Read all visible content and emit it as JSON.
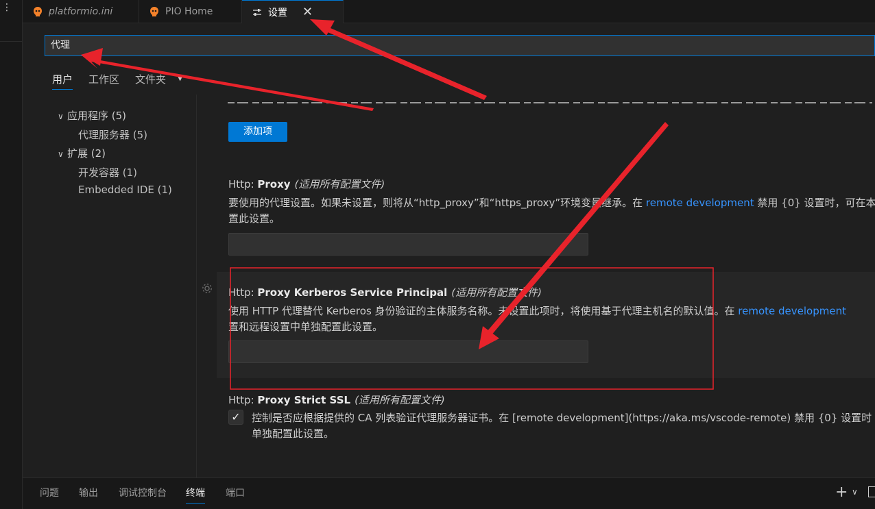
{
  "tabs": [
    {
      "label": "platformio.ini",
      "icon": "platformio-icon"
    },
    {
      "label": "PIO Home",
      "icon": "platformio-icon"
    },
    {
      "label": "设置",
      "icon": "settings-sliders-icon",
      "close": "✕"
    }
  ],
  "activity": {
    "more": "⋮"
  },
  "search": {
    "value": "代理"
  },
  "scope_tabs": [
    "用户",
    "工作区",
    "文件夹"
  ],
  "toc": [
    {
      "label": "应用程序 (5)",
      "chevron": "∨"
    },
    {
      "label": "代理服务器 (5)"
    },
    {
      "label": "扩展 (2)",
      "chevron": "∨"
    },
    {
      "label": "开发容器 (1)"
    },
    {
      "label": "Embedded IDE (1)"
    }
  ],
  "add_button": "添加项",
  "settings": {
    "proxy": {
      "category": "Http: ",
      "name": "Proxy",
      "hint": "(适用所有配置文件)",
      "desc_line1_a": "要使用的代理设置。如果未设置，则将从“http_proxy”和“https_proxy”环境变量继承。在 ",
      "desc_link": "remote development",
      "desc_line1_b": " 禁用 {0} 设置时，可在本",
      "desc_line2": "置此设置。"
    },
    "kerberos": {
      "category": "Http: ",
      "name": "Proxy Kerberos Service Principal",
      "hint": "(适用所有配置文件)",
      "desc_line1_a": "使用 HTTP 代理替代 Kerberos 身份验证的主体服务名称。未设置此项时，将使用基于代理主机名的默认值。在 ",
      "desc_link": "remote development",
      "desc_line2": "置和远程设置中单独配置此设置。"
    },
    "strict_ssl": {
      "category": "Http: ",
      "name": "Proxy Strict SSL",
      "hint": "(适用所有配置文件)",
      "checked": "✓",
      "desc_line1": "控制是否应根据提供的 CA 列表验证代理服务器证书。在 [remote development](https://aka.ms/vscode-remote) 禁用 {0} 设置时",
      "desc_line2": "单独配置此设置。"
    }
  },
  "panel_tabs": [
    "问题",
    "输出",
    "调试控制台",
    "终端",
    "端口"
  ],
  "panel_actions": {
    "add": "+",
    "dropdown": "∨"
  },
  "colors": {
    "accent": "#0078d4",
    "link": "#3794ff",
    "annotation": "#e8232b"
  }
}
